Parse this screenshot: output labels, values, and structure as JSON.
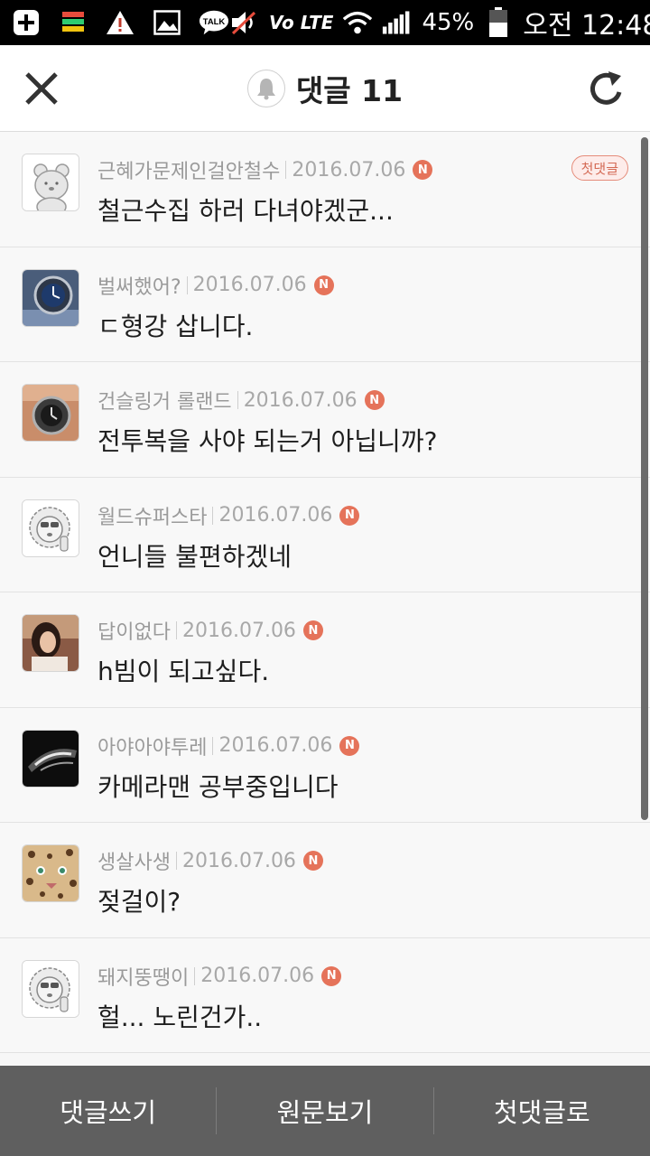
{
  "status_bar": {
    "left_icons": [
      "add-box-icon",
      "app-stack-icon",
      "warning-icon",
      "image-icon",
      "talk-bubble-icon"
    ],
    "talk_label": "TALK",
    "volte_label": "Vo LTE",
    "battery": "45%",
    "time": "오전 12:48"
  },
  "header": {
    "title": "댓글 11",
    "close_icon": "close-icon",
    "bell_icon": "bell-icon",
    "refresh_icon": "refresh-icon"
  },
  "comments": [
    {
      "author": "근혜가문제인걸안철수",
      "date": "2016.07.06",
      "new_badge": "N",
      "text": "철근수집 하러 다녀야겠군...",
      "first_badge": "첫댓글",
      "avatar": "default-bear-avatar"
    },
    {
      "author": "벌써했어?",
      "date": "2016.07.06",
      "new_badge": "N",
      "text": "ㄷ형강 삽니다.",
      "avatar": "blue-watch-avatar"
    },
    {
      "author": "건슬링거 롤랜드",
      "date": "2016.07.06",
      "new_badge": "N",
      "text": "전투복을 사야 되는거 아닙니까?",
      "avatar": "wrist-watch-avatar"
    },
    {
      "author": "월드슈퍼스타",
      "date": "2016.07.06",
      "new_badge": "N",
      "text": "언니들 불편하겠네",
      "avatar": "lion-avatar"
    },
    {
      "author": "답이없다",
      "date": "2016.07.06",
      "new_badge": "N",
      "text": "h빔이 되고싶다.",
      "avatar": "girl-photo-avatar"
    },
    {
      "author": "아야아야투레",
      "date": "2016.07.06",
      "new_badge": "N",
      "text": "카메라맨 공부중입니다",
      "avatar": "car-headlight-avatar"
    },
    {
      "author": "생살사생",
      "date": "2016.07.06",
      "new_badge": "N",
      "text": "젖걸이?",
      "avatar": "leopard-avatar"
    },
    {
      "author": "돼지뚱땡이",
      "date": "2016.07.06",
      "new_badge": "N",
      "text": "헐... 노린건가..",
      "avatar": "lion-avatar"
    }
  ],
  "bottom_bar": {
    "write": "댓글쓰기",
    "original": "원문보기",
    "first": "첫댓글로"
  },
  "colors": {
    "accent_badge": "#e5735a",
    "bottom_bar": "#5f5f5f",
    "list_bg": "#f8f8f8"
  }
}
